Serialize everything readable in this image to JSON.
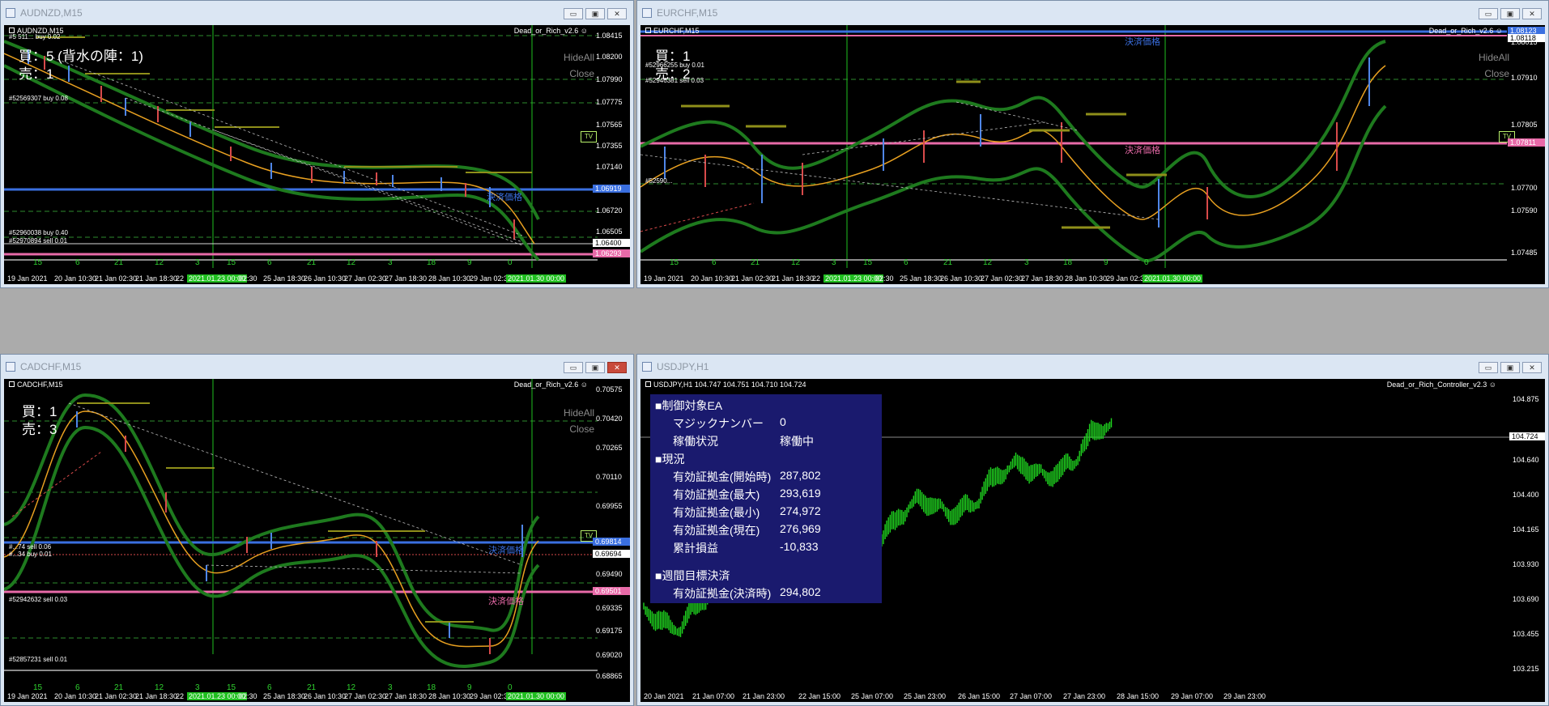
{
  "windows": [
    {
      "title": "AUDNZD,M15",
      "symbol_label": "AUDNZD,M15",
      "ea_label": "Dead_or_Rich_v2.6",
      "counts": "買：5 (背水の陣：1)\n売：1",
      "hide_all": "HideAll",
      "close": "Close",
      "price_axis": [
        "1.08415",
        "1.08200",
        "1.07990",
        "1.07775",
        "1.07565",
        "1.07355",
        "1.07140",
        "1.06930",
        "1.06720",
        "1.06505",
        "1.06290"
      ],
      "blue_price": "1.06919",
      "white_price": "1.06400",
      "pink_price": "1.06293",
      "orders": [
        "#52569307 buy 0.08",
        "#52960038 buy 0.40",
        "#52970894 sell 0.01",
        "#5 511... buy 0.02"
      ],
      "kessai": "決済価格",
      "day_nums": [
        "15",
        "6",
        "21",
        "12",
        "3",
        "15",
        "6",
        "21",
        "12",
        "3",
        "18",
        "9",
        "0"
      ],
      "time_axis": [
        "19 Jan 2021",
        "20 Jan 10:30",
        "21 Jan 02:30",
        "21 Jan 18:30",
        "22",
        "2021.01.23 00:00",
        "02:30",
        "25 Jan 18:30",
        "26 Jan 10:30",
        "27 Jan 02:30",
        "27 Jan 18:30",
        "28 Jan 10:30",
        "29 Jan 02:3",
        "2021.01.30 00:00"
      ],
      "tv": "TV"
    },
    {
      "title": "EURCHF,M15",
      "symbol_label": "EURCHF,M15",
      "ea_label": "Dead_or_Rich_v2.6",
      "counts": "買：1\n売：2",
      "hide_all": "HideAll",
      "close": "Close",
      "price_axis": [
        "1.08125",
        "1.08015",
        "1.07910",
        "1.07805",
        "1.07700",
        "1.07590",
        "1.07485"
      ],
      "blue_price": "1.08123",
      "white_price": "1.08118",
      "pink_price": "1.07811",
      "orders": [
        "#52966255 buy 0.01",
        "#52946381 sell 0.03",
        "#52590..."
      ],
      "kessai": "決済価格",
      "kessai2": "決済価格",
      "day_nums": [
        "15",
        "6",
        "21",
        "12",
        "3",
        "15",
        "6",
        "21",
        "12",
        "3",
        "18",
        "9",
        "0"
      ],
      "time_axis": [
        "19 Jan 2021",
        "20 Jan 10:30",
        "21 Jan 02:30",
        "21 Jan 18:30",
        "22",
        "2021.01.23 00:00",
        "02:30",
        "25 Jan 18:30",
        "26 Jan 10:30",
        "27 Jan 02:30",
        "27 Jan 18:30",
        "28 Jan 10:30",
        "29 Jan 02:3",
        "2021.01.30 00:00"
      ],
      "tv": "TV"
    },
    {
      "title": "CADCHF,M15",
      "symbol_label": "CADCHF,M15",
      "ea_label": "Dead_or_Rich_v2.6",
      "counts": "買：1\n売：3",
      "hide_all": "HideAll",
      "close": "Close",
      "price_axis": [
        "0.70575",
        "0.70420",
        "0.70265",
        "0.70110",
        "0.69955",
        "0.69800",
        "0.69645",
        "0.69490",
        "0.69335",
        "0.69175",
        "0.69020",
        "0.68865"
      ],
      "blue_price": "0.69814",
      "white_price": "0.69694",
      "pink_price": "0.69501",
      "orders": [
        "#...74 sell 0.06",
        "#...34 buy 0.01",
        "#52942632 sell 0.03",
        "#52857231 sell 0.01"
      ],
      "kessai": "決済価格",
      "kessai2": "決済価格",
      "day_nums": [
        "15",
        "6",
        "21",
        "12",
        "3",
        "15",
        "6",
        "21",
        "12",
        "3",
        "18",
        "9",
        "0"
      ],
      "time_axis": [
        "19 Jan 2021",
        "20 Jan 10:30",
        "21 Jan 02:30",
        "21 Jan 18:30",
        "22",
        "2021.01.23 00:00",
        "02:30",
        "25 Jan 18:30",
        "26 Jan 10:30",
        "27 Jan 02:30",
        "27 Jan 18:30",
        "28 Jan 10:30",
        "29 Jan 02:3",
        "2021.01.30 00:00"
      ],
      "tv": "TV"
    },
    {
      "title": "USDJPY,H1",
      "symbol_label": "USDJPY,H1  104.747 104.751 104.710 104.724",
      "ea_label": "Dead_or_Rich_Controller_v2.3",
      "price_axis": [
        "104.875",
        "104.640",
        "104.400",
        "104.165",
        "103.930",
        "103.690",
        "103.455",
        "103.215"
      ],
      "current_price": "104.724",
      "time_axis": [
        "20 Jan 2021",
        "21 Jan 07:00",
        "21 Jan 23:00",
        "22 Jan 15:00",
        "25 Jan 07:00",
        "25 Jan 23:00",
        "26 Jan 15:00",
        "27 Jan 07:00",
        "27 Jan 23:00",
        "28 Jan 15:00",
        "29 Jan 07:00",
        "29 Jan 23:00"
      ],
      "panel": {
        "h_ea": "■制御対象EA",
        "magic_label": "マジックナンバー",
        "magic_value": "0",
        "status_label": "稼働状況",
        "status_value": "稼働中",
        "h_now": "■現況",
        "eq_start_label": "有効証拠金(開始時)",
        "eq_start": "287,802",
        "eq_max_label": "有効証拠金(最大)",
        "eq_max": "293,619",
        "eq_min_label": "有効証拠金(最小)",
        "eq_min": "274,972",
        "eq_now_label": "有効証拠金(現在)",
        "eq_now": "276,969",
        "pl_label": "累計損益",
        "pl": "-10,833",
        "h_week": "■週間目標決済",
        "eq_settle_label": "有効証拠金(決済時)",
        "eq_settle": "294,802"
      }
    }
  ],
  "window_buttons": {
    "minimize": "▭",
    "maximize": "▣",
    "close": "✕"
  }
}
